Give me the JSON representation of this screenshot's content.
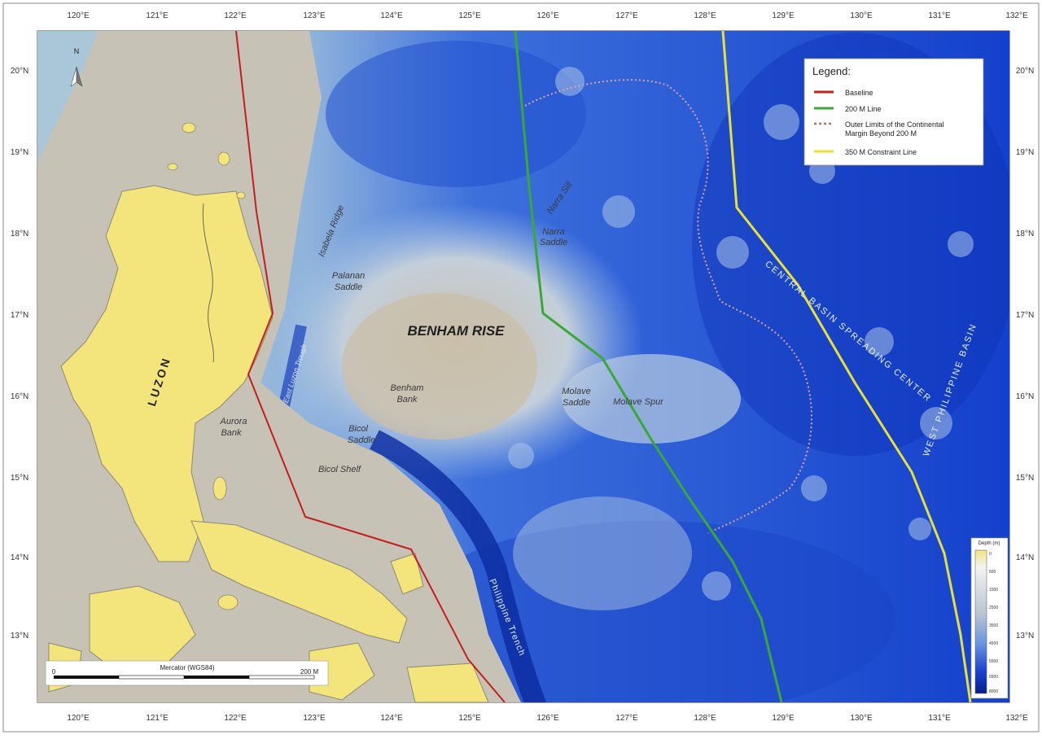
{
  "map": {
    "projection_note": "Mercator (WGS84)",
    "lon_ticks": [
      "120°E",
      "121°E",
      "122°E",
      "123°E",
      "124°E",
      "125°E",
      "126°E",
      "127°E",
      "128°E",
      "129°E",
      "130°E",
      "131°E",
      "132°E"
    ],
    "lat_ticks": [
      "20°N",
      "19°N",
      "18°N",
      "17°N",
      "16°N",
      "15°N",
      "14°N",
      "13°N"
    ],
    "north_arrow": "N",
    "scale_bar": {
      "title": "Mercator (WGS84)",
      "start": "0",
      "end": "200 M"
    },
    "labels": {
      "benham_rise": "BENHAM RISE",
      "luzon": "LUZON",
      "isabela_ridge": "Isabela Ridge",
      "palanan_saddle_1": "Palanan",
      "palanan_saddle_2": "Saddle",
      "narra_saddle_1": "Narra",
      "narra_saddle_2": "Saddle",
      "narra_sill": "Narra Sill",
      "east_luzon_trough": "East Luzon Trough",
      "benham_bank_1": "Benham",
      "benham_bank_2": "Bank",
      "aurora_bank_1": "Aurora",
      "aurora_bank_2": "Bank",
      "bicol_saddle_1": "Bicol",
      "bicol_saddle_2": "Saddle",
      "bicol_shelf": "Bicol Shelf",
      "molave_saddle_1": "Molave",
      "molave_saddle_2": "Saddle",
      "molave_spur": "Molave Spur",
      "philippine_trench": "Philippine Trench",
      "central_basin": "CENTRAL BASIN SPREADING CENTER",
      "west_philippine_basin": "WEST PHILIPPINE BASIN"
    },
    "legend": {
      "title": "Legend:",
      "items": [
        {
          "label": "Baseline",
          "color": "#c41e1e",
          "style": "solid"
        },
        {
          "label": "200 M Line",
          "color": "#3aa838",
          "style": "solid"
        },
        {
          "label": "Outer Limits of the Continental Margin Beyond 200 M",
          "label_line1": "Outer Limits of the Continental",
          "label_line2": "Margin Beyond 200 M",
          "color": "#c26a6a",
          "style": "dotted"
        },
        {
          "label": "350 M Constraint Line",
          "color": "#e8e03a",
          "style": "solid"
        }
      ]
    },
    "depth_scale": {
      "title": "Depth (m)",
      "values": [
        "0",
        "500",
        "1500",
        "2500",
        "3500",
        "4500",
        "5500",
        "6500",
        "8000"
      ]
    },
    "colors": {
      "land": "#f3e57c",
      "shallow": "#c8c3b5",
      "deep": "#1540d0",
      "abyss": "#0a2ba8"
    }
  }
}
